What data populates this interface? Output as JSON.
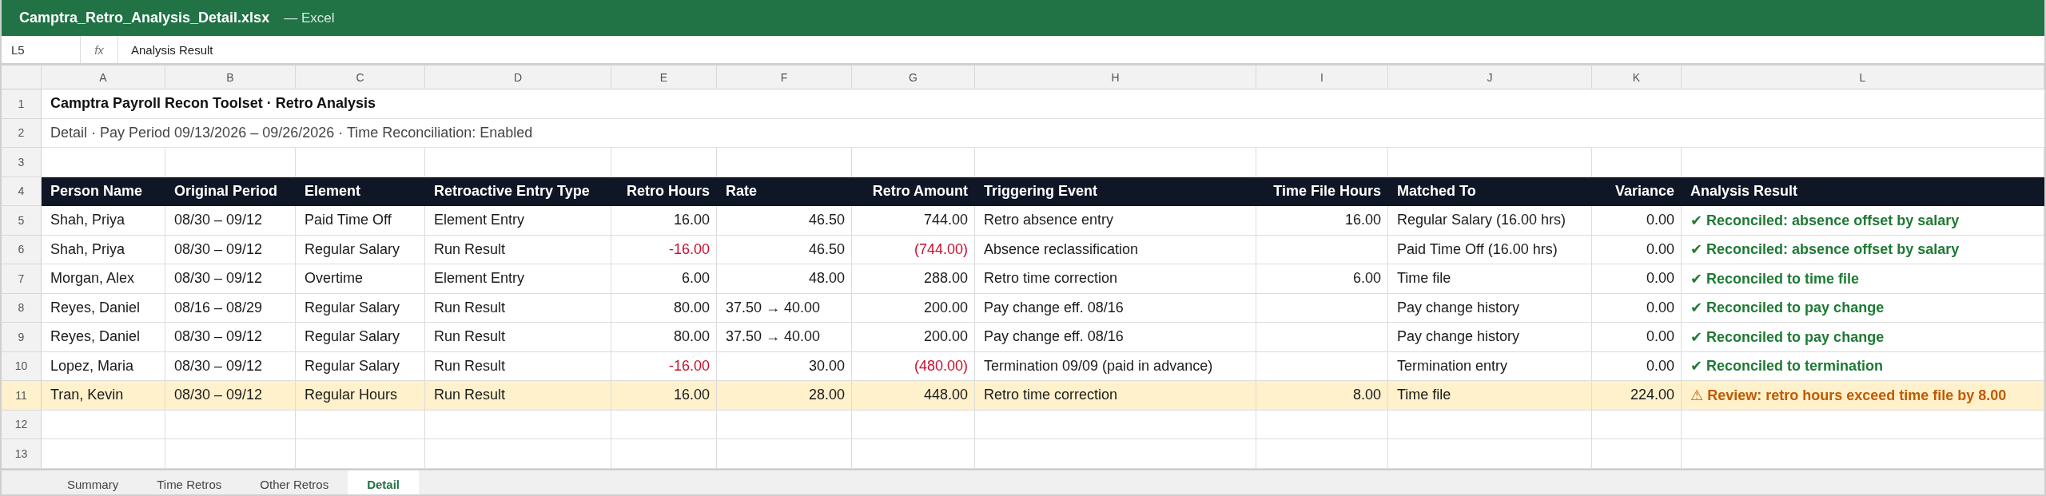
{
  "window": {
    "filename": "Camptra_Retro_Analysis_Detail.xlsx",
    "app": "— Excel"
  },
  "formula_bar": {
    "cell": "L5",
    "fx": "fx",
    "value": "Analysis Result"
  },
  "columns": [
    "A",
    "B",
    "C",
    "D",
    "E",
    "F",
    "G",
    "H",
    "I",
    "J",
    "K",
    "L"
  ],
  "title_row": {
    "number": "1",
    "text": "Camptra Payroll Recon Toolset  ·  Retro Analysis"
  },
  "subtitle_row": {
    "number": "2",
    "text": "Detail  ·  Pay Period 09/13/2026 – 09/26/2026  ·  Time Reconciliation: Enabled"
  },
  "blank_rows": [
    "3"
  ],
  "header_row": {
    "number": "4",
    "cells": [
      "Person Name",
      "Original Period",
      "Element",
      "Retroactive Entry Type",
      "Retro Hours",
      "Rate",
      "Retro Amount",
      "Triggering Event",
      "Time File Hours",
      "Matched To",
      "Variance",
      "Analysis Result"
    ]
  },
  "rows": [
    {
      "number": "5",
      "name": "Shah, Priya",
      "period": "08/30 – 09/12",
      "element": "Paid Time Off",
      "entry_type": "Element Entry",
      "retro_hours": "16.00",
      "rate": "46.50",
      "rate_changed": false,
      "retro_amount": "744.00",
      "event": "Retro absence entry",
      "time_file_hours": "16.00",
      "matched_to": "Regular Salary (16.00 hrs)",
      "variance": "0.00",
      "result": "✔ Reconciled: absence offset by salary",
      "negative": false,
      "flagged": false
    },
    {
      "number": "6",
      "name": "Shah, Priya",
      "period": "08/30 – 09/12",
      "element": "Regular Salary",
      "entry_type": "Run Result",
      "retro_hours": "-16.00",
      "rate": "46.50",
      "rate_changed": false,
      "retro_amount": "(744.00)",
      "event": "Absence reclassification",
      "matched_to": "Paid Time Off (16.00 hrs)",
      "variance": "0.00",
      "result": "✔ Reconciled: absence offset by salary",
      "negative": true,
      "flagged": false
    },
    {
      "number": "7",
      "name": "Morgan, Alex",
      "period": "08/30 – 09/12",
      "element": "Overtime",
      "entry_type": "Element Entry",
      "retro_hours": "6.00",
      "rate": "48.00",
      "rate_changed": false,
      "retro_amount": "288.00",
      "event": "Retro time correction",
      "time_file_hours": "6.00",
      "matched_to": "Time file",
      "variance": "0.00",
      "result": "✔ Reconciled to time file",
      "negative": false,
      "flagged": false
    },
    {
      "number": "8",
      "name": "Reyes, Daniel",
      "period": "08/16 – 08/29",
      "element": "Regular Salary",
      "entry_type": "Run Result",
      "retro_hours": "80.00",
      "rate": "37.50 → 40.00",
      "rate_changed": true,
      "retro_amount": "200.00",
      "event": "Pay change eff. 08/16",
      "matched_to": "Pay change history",
      "variance": "0.00",
      "result": "✔ Reconciled to pay change",
      "negative": false,
      "flagged": false
    },
    {
      "number": "9",
      "name": "Reyes, Daniel",
      "period": "08/30 – 09/12",
      "element": "Regular Salary",
      "entry_type": "Run Result",
      "retro_hours": "80.00",
      "rate": "37.50 → 40.00",
      "rate_changed": true,
      "retro_amount": "200.00",
      "event": "Pay change eff. 08/16",
      "matched_to": "Pay change history",
      "variance": "0.00",
      "result": "✔ Reconciled to pay change",
      "negative": false,
      "flagged": false
    },
    {
      "number": "10",
      "name": "Lopez, Maria",
      "period": "08/30 – 09/12",
      "element": "Regular Salary",
      "entry_type": "Run Result",
      "retro_hours": "-16.00",
      "rate": "30.00",
      "rate_changed": false,
      "retro_amount": "(480.00)",
      "event": "Termination 09/09 (paid in advance)",
      "matched_to": "Termination entry",
      "variance": "0.00",
      "result": "✔ Reconciled to termination",
      "negative": true,
      "flagged": false
    },
    {
      "number": "11",
      "name": "Tran, Kevin",
      "period": "08/30 – 09/12",
      "element": "Regular Hours",
      "entry_type": "Run Result",
      "retro_hours": "16.00",
      "rate": "28.00",
      "rate_changed": false,
      "retro_amount": "448.00",
      "event": "Retro time correction",
      "time_file_hours": "8.00",
      "matched_to": "Time file",
      "variance": "224.00",
      "result": "⚠ Review: retro hours exceed time file by 8.00",
      "negative": false,
      "flagged": true
    }
  ],
  "trailing_rows": [
    "12",
    "13"
  ],
  "sheet_tabs": [
    {
      "label": "Summary",
      "selected": false
    },
    {
      "label": "Time Retros",
      "selected": false
    },
    {
      "label": "Other Retros",
      "selected": false
    },
    {
      "label": "Detail",
      "selected": true
    }
  ]
}
